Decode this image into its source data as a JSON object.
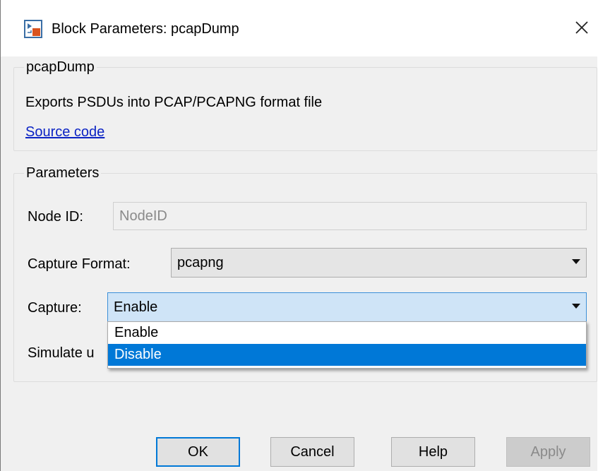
{
  "window": {
    "title": "Block Parameters: pcapDump",
    "close_glyph": "✕"
  },
  "block": {
    "legend": "pcapDump",
    "description": "Exports PSDUs into PCAP/PCAPNG format file",
    "source_link": "Source code"
  },
  "parameters": {
    "legend": "Parameters",
    "node_id": {
      "label": "Node ID:",
      "value": "NodeID"
    },
    "capture_format": {
      "label": "Capture Format:",
      "value": "pcapng"
    },
    "capture": {
      "label": "Capture:",
      "value": "Enable",
      "options": [
        "Enable",
        "Disable"
      ],
      "highlighted": "Disable"
    },
    "simulate_partial": "Simulate u"
  },
  "buttons": {
    "ok": "OK",
    "cancel": "Cancel",
    "help": "Help",
    "apply": "Apply"
  },
  "colors": {
    "link": "#0b23c4",
    "highlight": "#0078d7",
    "active_combo": "#cfe4f7"
  },
  "icons": {
    "app": "simulink-block-icon",
    "close": "close-icon",
    "dropdown": "chevron-down-icon"
  }
}
